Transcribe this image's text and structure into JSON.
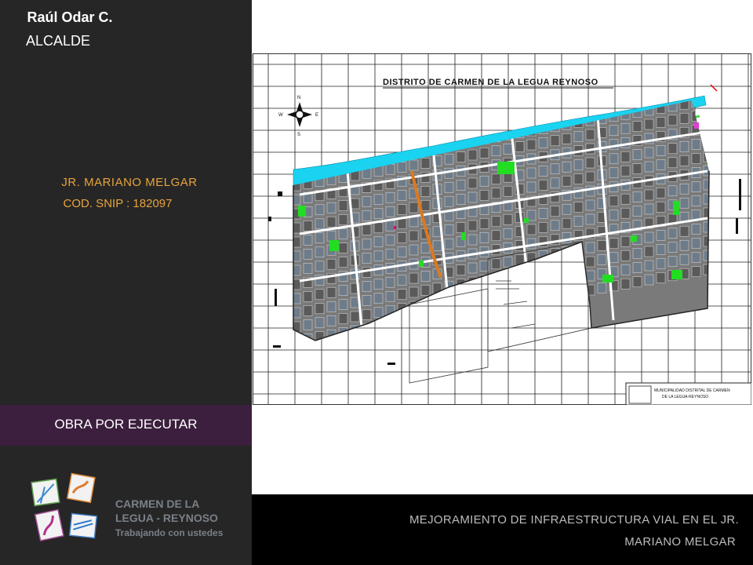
{
  "left_panel": {
    "mayor_name": "Raúl Odar C.",
    "mayor_title": "ALCALDE",
    "project_name": "JR. MARIANO MELGAR",
    "project_code": "COD. SNIP : 182097"
  },
  "status_banner": {
    "label": "OBRA POR EJECUTAR"
  },
  "logo": {
    "line1": "CARMEN DE LA",
    "line2": "LEGUA - REYNOSO",
    "tagline": "Trabajando con ustedes"
  },
  "map": {
    "title": "DISTRITO DE CARMEN DE LA LEGUA REYNOSO",
    "compass_n": "N",
    "compass_s": "S",
    "compass_e": "E",
    "compass_w": "W",
    "title_block_line1": "MUNICIPALIDAD DISTRITAL DE CARMEN",
    "title_block_line2": "DE LA LEGUA-REYNOSO",
    "colors": {
      "river": "#19d3f0",
      "parks": "#22dd22",
      "highlighted_street": "#d97a22",
      "blocks": "#444444"
    }
  },
  "footer": {
    "line1": "MEJORAMIENTO DE INFRAESTRUCTURA VIAL EN EL JR.",
    "line2": "MARIANO MELGAR"
  }
}
